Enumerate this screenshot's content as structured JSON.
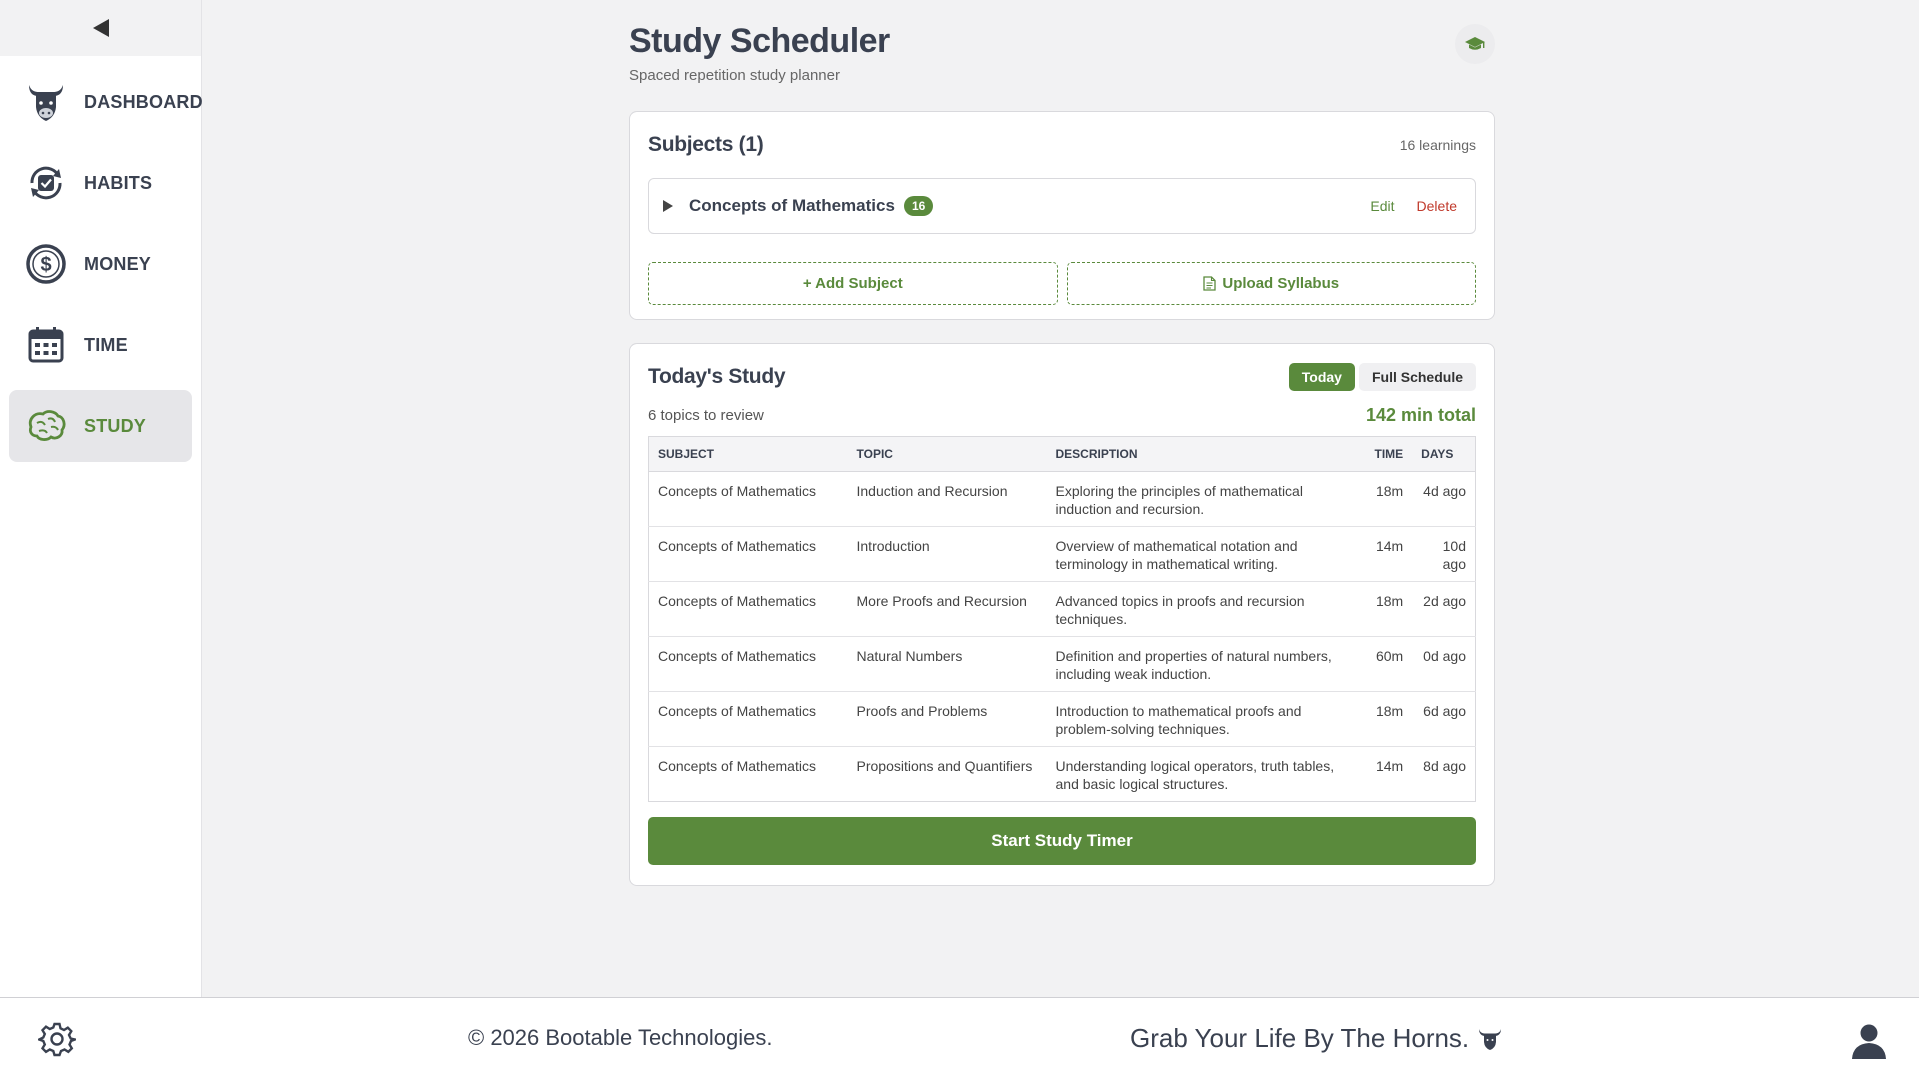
{
  "sidebar": {
    "items": [
      {
        "label": "DASHBOARD",
        "icon": "bull-icon"
      },
      {
        "label": "HABITS",
        "icon": "habit-cycle-icon"
      },
      {
        "label": "MONEY",
        "icon": "dollar-icon"
      },
      {
        "label": "TIME",
        "icon": "calendar-icon"
      },
      {
        "label": "STUDY",
        "icon": "brain-icon",
        "active": true
      }
    ]
  },
  "header": {
    "title": "Study Scheduler",
    "subtitle": "Spaced repetition study planner"
  },
  "subjects": {
    "title": "Subjects (1)",
    "learnings": "16 learnings",
    "items": [
      {
        "name": "Concepts of Mathematics",
        "count": "16",
        "edit": "Edit",
        "delete": "Delete"
      }
    ],
    "add_label": "+ Add Subject",
    "upload_label": "Upload Syllabus"
  },
  "study": {
    "title": "Today's Study",
    "tab_today": "Today",
    "tab_full": "Full Schedule",
    "topics_count": "6 topics to review",
    "total": "142 min total",
    "columns": [
      "SUBJECT",
      "TOPIC",
      "DESCRIPTION",
      "TIME",
      "DAYS"
    ],
    "rows": [
      {
        "subject": "Concepts of Mathematics",
        "topic": "Induction and Recursion",
        "description": "Exploring the principles of mathematical induction and recursion.",
        "time": "18m",
        "days": "4d ago"
      },
      {
        "subject": "Concepts of Mathematics",
        "topic": "Introduction",
        "description": "Overview of mathematical notation and terminology in mathematical writing.",
        "time": "14m",
        "days": "10d ago"
      },
      {
        "subject": "Concepts of Mathematics",
        "topic": "More Proofs and Recursion",
        "description": "Advanced topics in proofs and recursion techniques.",
        "time": "18m",
        "days": "2d ago"
      },
      {
        "subject": "Concepts of Mathematics",
        "topic": "Natural Numbers",
        "description": "Definition and properties of natural numbers, including weak induction.",
        "time": "60m",
        "days": "0d ago"
      },
      {
        "subject": "Concepts of Mathematics",
        "topic": "Proofs and Problems",
        "description": "Introduction to mathematical proofs and problem-solving techniques.",
        "time": "18m",
        "days": "6d ago"
      },
      {
        "subject": "Concepts of Mathematics",
        "topic": "Propositions and Quantifiers",
        "description": "Understanding logical operators, truth tables, and basic logical structures.",
        "time": "14m",
        "days": "8d ago"
      }
    ],
    "start_label": "Start Study Timer"
  },
  "footer": {
    "copyright": "© 2026 Bootable Technologies.",
    "tagline": "Grab Your Life By The Horns."
  },
  "colors": {
    "accent": "#5a8a3c",
    "danger": "#c0392b",
    "text": "#3a4150"
  }
}
